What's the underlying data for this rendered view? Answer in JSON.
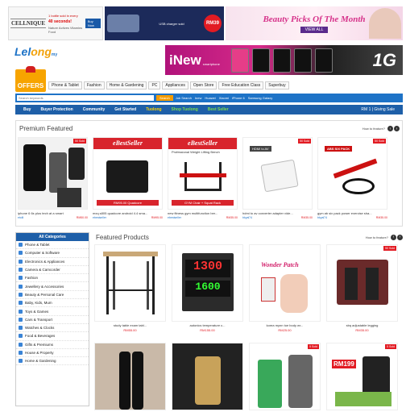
{
  "top_banners": {
    "b1": {
      "brand": "CELLNIQUE",
      "line1": "1 bottle sold in every",
      "line2": "40 seconds!",
      "line3": "Nature Actives Vitamins Food",
      "cta": "Buy Now"
    },
    "b2": {
      "price": "RM39",
      "note": "USB charger sold"
    },
    "b3": {
      "title": "Beauty Picks Of The Month",
      "cta": "VIEW ALL"
    }
  },
  "logo": {
    "part1": "Lel",
    "part2": "ong",
    "suffix": "my"
  },
  "ad2": {
    "brand": "iNew",
    "sub": "smartphone",
    "tag": "1G"
  },
  "offers": {
    "label": "OFFERS"
  },
  "category_nav": [
    "Phone & Tablet",
    "Fashion",
    "Home & Gardening",
    "PC",
    "Appliances",
    "Open Store",
    "Free Education Class",
    "Superbuy"
  ],
  "search": {
    "placeholder": "Search keywords",
    "button": "Search",
    "links": [
      "Job Search",
      "Inew",
      "Huawei",
      "Xiaomi",
      "iPhone 6",
      "Samsung Galaxy"
    ]
  },
  "nav": {
    "items": [
      "Buy",
      "Buyer Protection",
      "Community",
      "Get Started"
    ],
    "highlight": "Tuolong",
    "green1": "Shop Tuolong",
    "green2": "Best Seller",
    "right": "RM 1  |  Giving Sale"
  },
  "premium": {
    "title": "Premium Featured",
    "howto": "How to feature?",
    "items": [
      {
        "name": "iphone 6 6s plus tech at a smart",
        "seller": "etolli",
        "price": "RM50.00",
        "tag": "50 Sold"
      },
      {
        "name": "mxq s805 quadcore android 4.4 sma...",
        "seller": "ebestseller",
        "price": "RM95.00",
        "tag": "",
        "banner": "eBestSeller",
        "banner_sub": "RM95.00 Quadcore"
      },
      {
        "name": "new fitness gym multifunction ber...",
        "seller": "ebestseller",
        "price": "RM35.00",
        "tag": "",
        "banner": "eBestSeller",
        "banner_sub": "GYM Chair + Squat Rack",
        "banner_top": "Professional Weight Lifting Bench"
      },
      {
        "name": "hdmi to av converter adapter vide...",
        "seller": "bkyal74",
        "price": "RM35.00",
        "tag": "50 Sold",
        "badge": "HDMI to AV"
      },
      {
        "name": "gym ab six pack power exercise sha...",
        "seller": "bkyal74",
        "price": "RM35.00",
        "tag": "50 Sold",
        "badge": "ABS SIX PACK"
      }
    ]
  },
  "sidebar": {
    "header": "All Categories",
    "items": [
      "Phone & Tablet",
      "Computer & Software",
      "Electronics & Appliances",
      "Camera & Camcorder",
      "Fashion",
      "Jewellery & Accessories",
      "Beauty & Personal Care",
      "Baby, Kids, Mum",
      "Toys & Games",
      "Cars & Transport",
      "Watches & Clocks",
      "Food & Beverages",
      "Gifts & Premiums",
      "House & Property",
      "Home & Gardening"
    ]
  },
  "featured": {
    "title": "Featured Products",
    "howto": "How to feature?",
    "items": [
      {
        "name": "study table exam tabl...",
        "price": "RM55.00",
        "tag": ""
      },
      {
        "name": "autonics temperature c...",
        "price": "RM155.00",
        "tag": "",
        "display1": "1300",
        "display2": "1600"
      },
      {
        "name": "korea mynn toe body wr...",
        "price": "RM25.00",
        "tag": "",
        "badge": "Wonder Patch"
      },
      {
        "name": "sbq adjustable legging",
        "price": "RM35.00",
        "tag": "50 Sold"
      }
    ],
    "row2": [
      {
        "tag": ""
      },
      {
        "tag": ""
      },
      {
        "tag": "5 Sold"
      },
      {
        "tag": "5 Sold",
        "price_badge": "RM199"
      }
    ]
  }
}
